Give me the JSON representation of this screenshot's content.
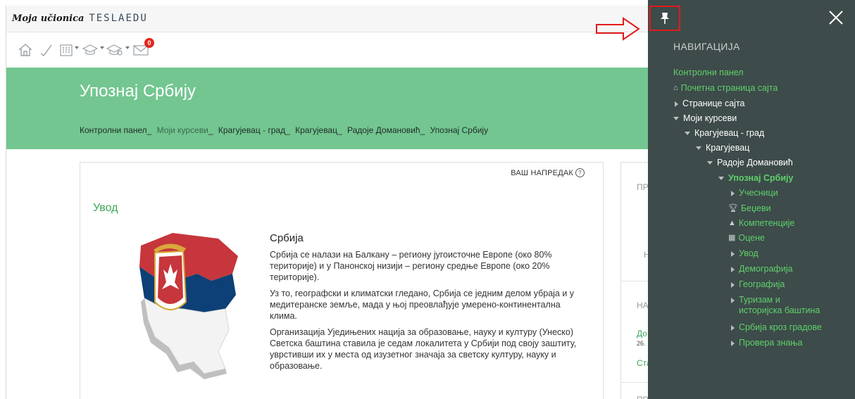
{
  "brand": {
    "prefix": "Moja učionica",
    "name": "TESLAEDU"
  },
  "iconbar": {
    "items": [
      {
        "icon": "home-icon"
      },
      {
        "icon": "checkmark-icon"
      },
      {
        "icon": "calendar-icon"
      },
      {
        "icon": "graduation-cap-icon"
      },
      {
        "icon": "graduation-cap-settings-icon"
      },
      {
        "icon": "envelope-icon",
        "badge": "0"
      }
    ]
  },
  "hero": {
    "title": "Упознај Србију",
    "breadcrumbs": [
      "Контролни панел",
      "Моји курсеви",
      "Крагујевац - град",
      "Крагујевац",
      "Радоје Домановић",
      "Упознај Србију"
    ]
  },
  "card": {
    "progress_label": "ВАШ НАПРЕДАК",
    "section_title": "Увод",
    "heading": "Србија",
    "paragraphs": [
      "Србија се налази на Балкану – региону југоисточне Европе (око 80% територије) и у Панонској низији – региону средње Европе (око 20% територије).",
      "Уз то, географски и климатски гледано, Србија се једним делом убраја и у медитеранске земље, мада у њој преовлађује умерено-континентална клима.",
      "Организација Уједињених нација за образовање, науку и културу (Унеско) Светска баштина ставила је седам локалитета у Србији под своју заштиту, уврстивши их у места од изузетног значаја за светску културу, науку и образовање."
    ],
    "colors": {
      "flag_red": "#c6363c",
      "flag_blue": "#0c4076"
    }
  },
  "right_column": {
    "block1_title": "ПР",
    "block1_text": "Н",
    "block2_title": "НА",
    "block2_link": "До",
    "block2_date": "26.",
    "block2_link2": "Ста",
    "block3_title": "ПР"
  },
  "drawer": {
    "heading": "НАВИГАЦИЈА",
    "items": [
      {
        "label": "Контролни панел",
        "color": "green",
        "marker": "none",
        "indent": 0
      },
      {
        "label": "Почетна страница сајта",
        "color": "green",
        "marker": "home",
        "indent": 0
      },
      {
        "label": "Странице сајта",
        "color": "white",
        "marker": "collapsed",
        "indent": 0
      },
      {
        "label": "Моји курсеви",
        "color": "white",
        "marker": "expanded",
        "indent": 0
      },
      {
        "label": "Крагујевац - град",
        "color": "white",
        "marker": "expanded",
        "indent": 1
      },
      {
        "label": "Крагујевац",
        "color": "white",
        "marker": "expanded",
        "indent": 2
      },
      {
        "label": "Радоје Домановић",
        "color": "white",
        "marker": "expanded",
        "indent": 3
      },
      {
        "label": "Упознај Србију",
        "color": "green",
        "marker": "expanded",
        "indent": 4,
        "bold": true
      },
      {
        "label": "Учесници",
        "color": "green",
        "marker": "collapsed",
        "indent": 5
      },
      {
        "label": "Беџеви",
        "color": "green",
        "marker": "trophy",
        "indent": 5
      },
      {
        "label": "Компетенције",
        "color": "green",
        "marker": "competency",
        "indent": 5
      },
      {
        "label": "Оцене",
        "color": "green",
        "marker": "grades",
        "indent": 5
      },
      {
        "label": "Увод",
        "color": "green",
        "marker": "collapsed",
        "indent": 5
      },
      {
        "label": "Демографија",
        "color": "green",
        "marker": "collapsed",
        "indent": 5
      },
      {
        "label": "Географија",
        "color": "green",
        "marker": "collapsed",
        "indent": 5
      },
      {
        "label": "Туризам и",
        "label2": "историјска баштина",
        "color": "green",
        "marker": "collapsed",
        "indent": 5
      },
      {
        "label": "Србија кроз градове",
        "color": "green",
        "marker": "collapsed",
        "indent": 5
      },
      {
        "label": "Провера знања",
        "color": "green",
        "marker": "collapsed",
        "indent": 5
      }
    ]
  },
  "annotations": {
    "arrow_color": "#e21b1b",
    "pin_box_color": "#e21b1b"
  }
}
